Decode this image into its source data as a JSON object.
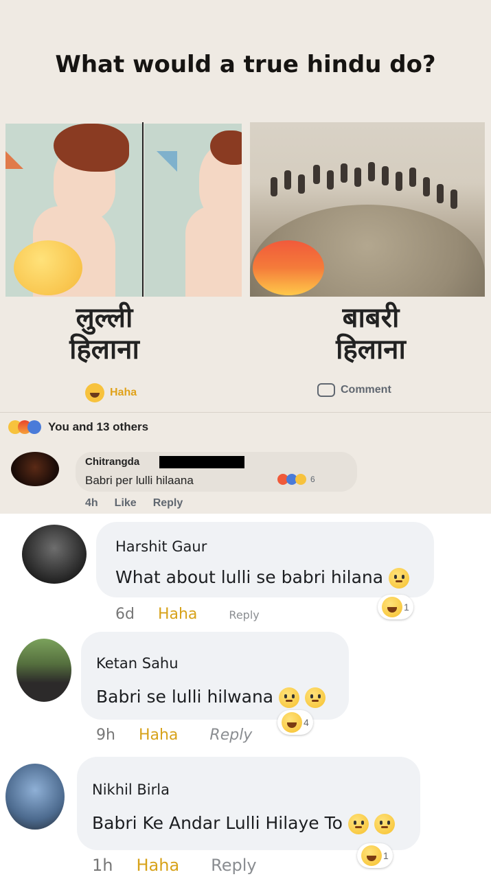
{
  "meme": {
    "title": "What would a true hindu do?",
    "left_caption_line1": "लुल्ली",
    "left_caption_line2": "हिलाना",
    "right_caption_line1": "बाबरी",
    "right_caption_line2": "हिलाना",
    "left_reaction_icon": "sad-emoji-icon",
    "right_reaction_icon": "angry-emoji-icon"
  },
  "action_bar": {
    "haha_label": "Haha",
    "comment_label": "Comment"
  },
  "reactions_summary": {
    "text": "You and 13 others"
  },
  "comments": [
    {
      "author": "Chitrangda",
      "text": "Babri per lulli hilaana",
      "reaction_count": "6",
      "time": "4h",
      "like_label": "Like",
      "reply_label": "Reply"
    },
    {
      "author": "Harshit Gaur",
      "text": "What about lulli se babri hilana",
      "time": "6d",
      "haha_label": "Haha",
      "reply_label": "Reply",
      "reaction_count": "1"
    },
    {
      "author": "Ketan Sahu",
      "text": "Babri se lulli hilwana",
      "time": "9h",
      "haha_label": "Haha",
      "reply_label": "Reply",
      "reaction_count": "4"
    },
    {
      "author": "Nikhil Birla",
      "text": "Babri Ke Andar Lulli Hilaye To",
      "time": "1h",
      "haha_label": "Haha",
      "reply_label": "Reply",
      "reaction_count": "1"
    }
  ],
  "colors": {
    "haha_accent": "#d7a21a",
    "bubble_bg": "#f0f2f5",
    "post_bg": "#efeae3"
  }
}
